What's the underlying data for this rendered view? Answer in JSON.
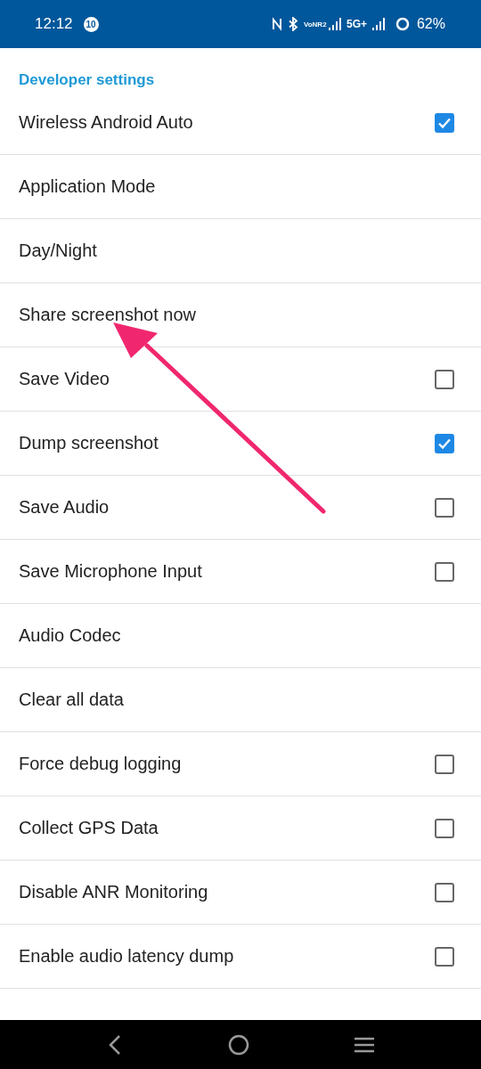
{
  "status_bar": {
    "time": "12:12",
    "notification_badge": "10",
    "network_label": "VoNR2",
    "network_type": "5G+",
    "battery": "62%"
  },
  "section_header": "Developer settings",
  "settings": [
    {
      "label": "Wireless Android Auto",
      "kind": "checkbox",
      "checked": true
    },
    {
      "label": "Application Mode",
      "kind": "plain"
    },
    {
      "label": "Day/Night",
      "kind": "plain"
    },
    {
      "label": "Share screenshot now",
      "kind": "plain"
    },
    {
      "label": "Save Video",
      "kind": "checkbox",
      "checked": false
    },
    {
      "label": "Dump screenshot",
      "kind": "checkbox",
      "checked": true
    },
    {
      "label": "Save Audio",
      "kind": "checkbox",
      "checked": false
    },
    {
      "label": "Save Microphone Input",
      "kind": "checkbox",
      "checked": false
    },
    {
      "label": "Audio Codec",
      "kind": "plain"
    },
    {
      "label": "Clear all data",
      "kind": "plain"
    },
    {
      "label": "Force debug logging",
      "kind": "checkbox",
      "checked": false
    },
    {
      "label": "Collect GPS Data",
      "kind": "checkbox",
      "checked": false
    },
    {
      "label": "Disable ANR Monitoring",
      "kind": "checkbox",
      "checked": false
    },
    {
      "label": "Enable audio latency dump",
      "kind": "checkbox",
      "checked": false
    }
  ]
}
